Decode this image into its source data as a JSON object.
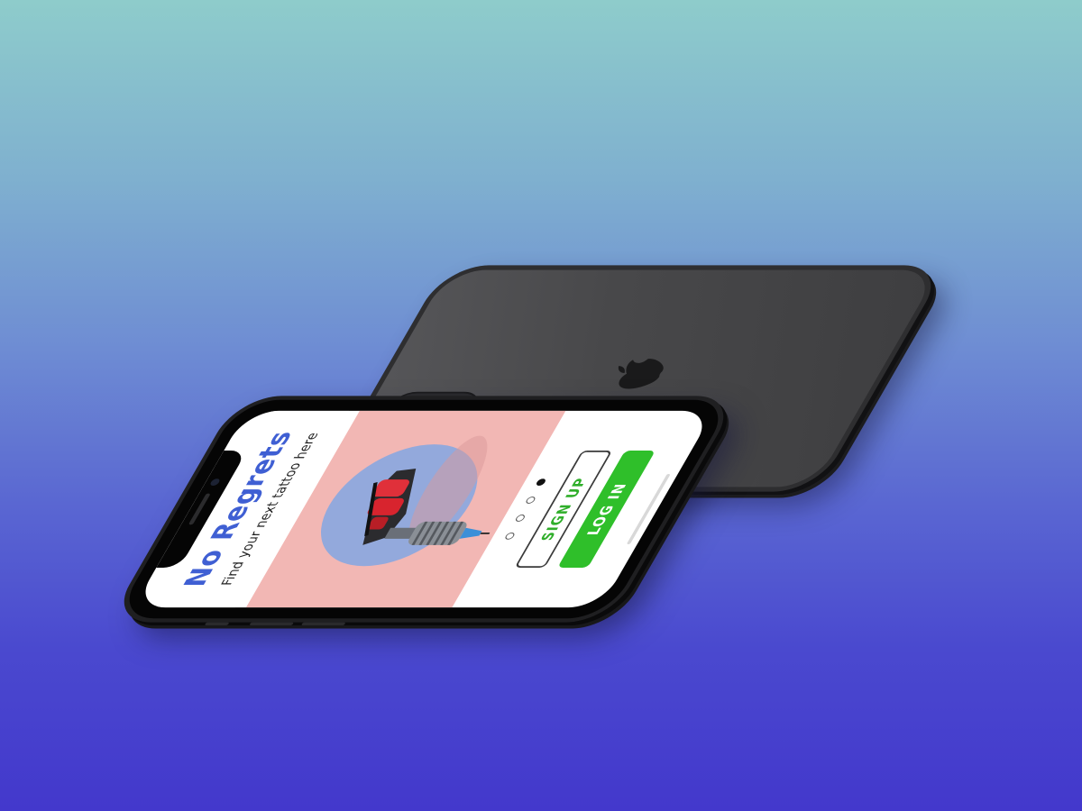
{
  "app": {
    "title": "No Regrets",
    "subtitle": "Find your next tattoo here",
    "hero_icon": "tattoo-machine",
    "pager": {
      "total": 4,
      "active_index": 3
    },
    "buttons": {
      "signup_label": "SIGN UP",
      "login_label": "LOG IN"
    }
  },
  "colors": {
    "title": "#3f5fd3",
    "hero_background": "#f2b7b4",
    "hero_circle": "#93a9dc",
    "login_button": "#2fbf2a",
    "signup_text": "#2fae2a",
    "back_phone": "#48484a"
  },
  "device": {
    "back_logo_icon": "apple-logo-icon",
    "camera_icon": "triple-camera-icon"
  }
}
